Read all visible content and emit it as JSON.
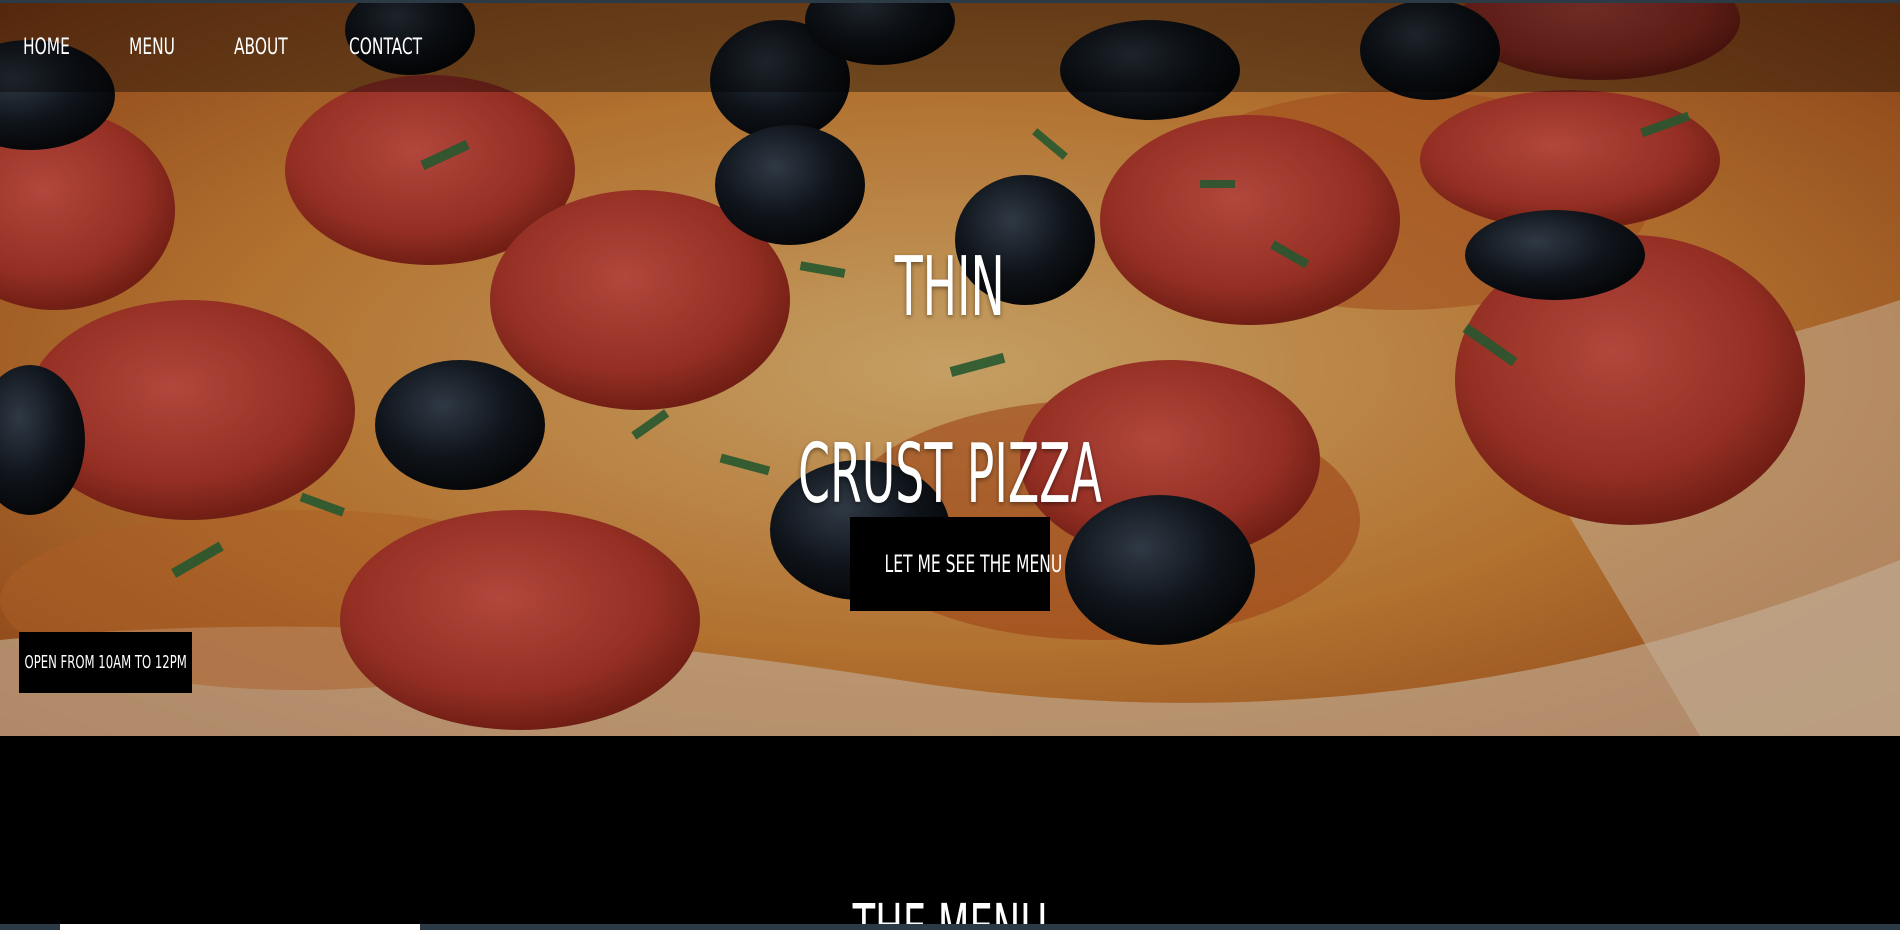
{
  "nav": {
    "items": [
      {
        "label": "HOME"
      },
      {
        "label": "MENU"
      },
      {
        "label": "ABOUT"
      },
      {
        "label": "CONTACT"
      }
    ]
  },
  "hero": {
    "title_line1": "THIN",
    "title_line2": "CRUST PIZZA",
    "cta_label": "LET ME SEE THE MENU",
    "hours_label": "OPEN FROM 10AM TO 12PM"
  },
  "menu_section": {
    "title": "THE MENU"
  },
  "colors": {
    "nav_overlay": "#000000",
    "button_bg": "#000000",
    "text": "#ffffff",
    "section_bg": "#000000",
    "frame_bar": "#2b3a44"
  },
  "icons": []
}
